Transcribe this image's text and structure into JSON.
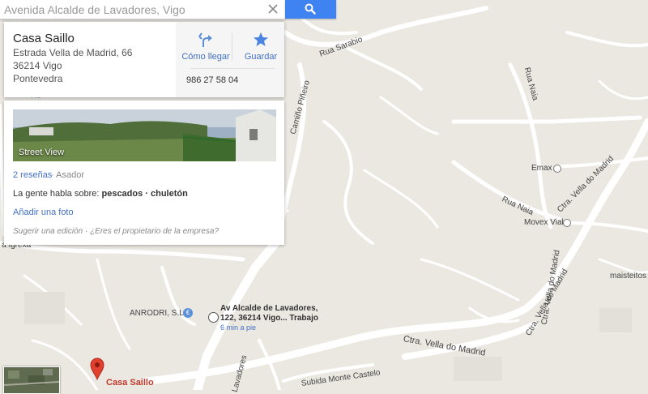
{
  "search": {
    "value": "Avenida Alcalde de Lavadores, Vigo"
  },
  "place": {
    "name": "Casa Saillo",
    "address_lines": [
      "Estrada Vella de Madrid, 66",
      "36214 Vigo",
      "Pontevedra"
    ],
    "phone": "986 27 58 04",
    "actions": {
      "directions": "Cómo llegar",
      "save": "Guardar"
    }
  },
  "details": {
    "street_view_label": "Street View",
    "reviews": "2 reseñas",
    "category_sep": "·",
    "category": "Asador",
    "talk_prefix": "La gente habla sobre:",
    "talk_topics": "pescados · chuletón",
    "add_photo": "Añadir una foto",
    "suggest_edit": "Sugerir una edición",
    "footer_sep": "·",
    "owner_question": "¿Eres el propietario de la empresa?"
  },
  "map": {
    "street_labels": {
      "rua_sarabio": "Rua Sarabio",
      "camino_pineiro": "Camiño Piñeiro",
      "rua_naia_n": "Rua Naia",
      "rua_naia_s": "Rua Naia",
      "ctra_vella_1": "Ctra. Vella do Madrid",
      "ctra_vella_2": "Ctra. Vella do Madrid",
      "ctra_vella_3": "Ctra. Vella do Madrid",
      "ctra_vella_4": "Ctra. Vella do Madrid",
      "subida_monte": "Subida Monte Castelo",
      "lavadores": "Lavadores",
      "ro": "Ro",
      "igrexa": "a Igrexa"
    },
    "pois": {
      "emax": "Emax",
      "movex": "Movex Vial",
      "maisteitos": "maisteitos",
      "anrodri": "ANRODRI, S.L."
    },
    "transit": {
      "line1": "Av Alcalde de Lavadores,",
      "line2": "122, 36214 Vigo... Trabajo",
      "walk": "6 min a pie"
    },
    "marker_label": "Casa Saillo"
  },
  "colors": {
    "accent": "#3f82f2",
    "link": "#4270c5",
    "land": "#ebe8e2",
    "road": "#ffffff",
    "marker": "#e0412f"
  }
}
